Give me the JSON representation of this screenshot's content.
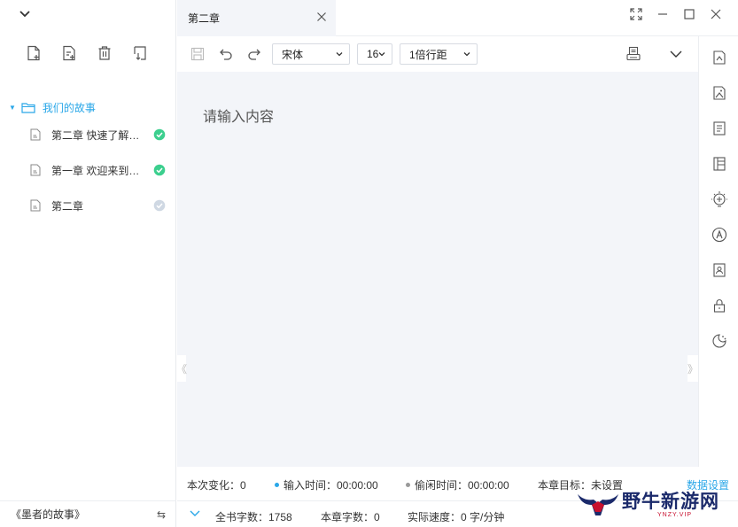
{
  "sidebar": {
    "tree": {
      "root_label": "我们的故事",
      "items": [
        {
          "label": "第二章 快速了解墨者写作",
          "status": "saved"
        },
        {
          "label": "第一章 欢迎来到墨者写作",
          "status": "saved"
        },
        {
          "label": "第二章",
          "status": "pending"
        }
      ]
    },
    "footer_label": "《墨者的故事》",
    "footer_swap_symbol": "⇆"
  },
  "tabbar": {
    "active_tab": "第二章"
  },
  "toolbar": {
    "font_family": "宋体",
    "font_size": "16",
    "line_spacing": "1倍行距"
  },
  "editor": {
    "placeholder": "请输入内容",
    "left_edge": "《",
    "right_edge": "》"
  },
  "status": {
    "change_label": "本次变化：0",
    "input_time": "输入时间：00:00:00",
    "idle_time": "偷闲时间：00:00:00",
    "chapter_goal": "本章目标：未设置",
    "data_settings": "数据设置",
    "book_words": "全书字数：1758",
    "chapter_words": "本章字数：0",
    "actual_speed": "实际速度：0 字/分钟"
  },
  "watermark": {
    "text": "野牛新游网",
    "sub": "YNZY.VIP"
  },
  "colors": {
    "accent": "#2aa7e8",
    "check_done": "#3ccf8e",
    "check_pending": "#cfd8e3",
    "editor_bg": "#f3f5f9",
    "input_dot": "#2aa7e8",
    "idle_dot": "#999999"
  },
  "icons": {
    "sidebar_tools": [
      "new-file-icon",
      "new-chapter-icon",
      "trash-icon",
      "sort-icon"
    ],
    "rail": [
      "outline-icon",
      "image-icon",
      "note-icon",
      "table-icon",
      "idea-icon",
      "font-check-icon",
      "character-icon",
      "lock-icon",
      "theme-icon"
    ]
  }
}
